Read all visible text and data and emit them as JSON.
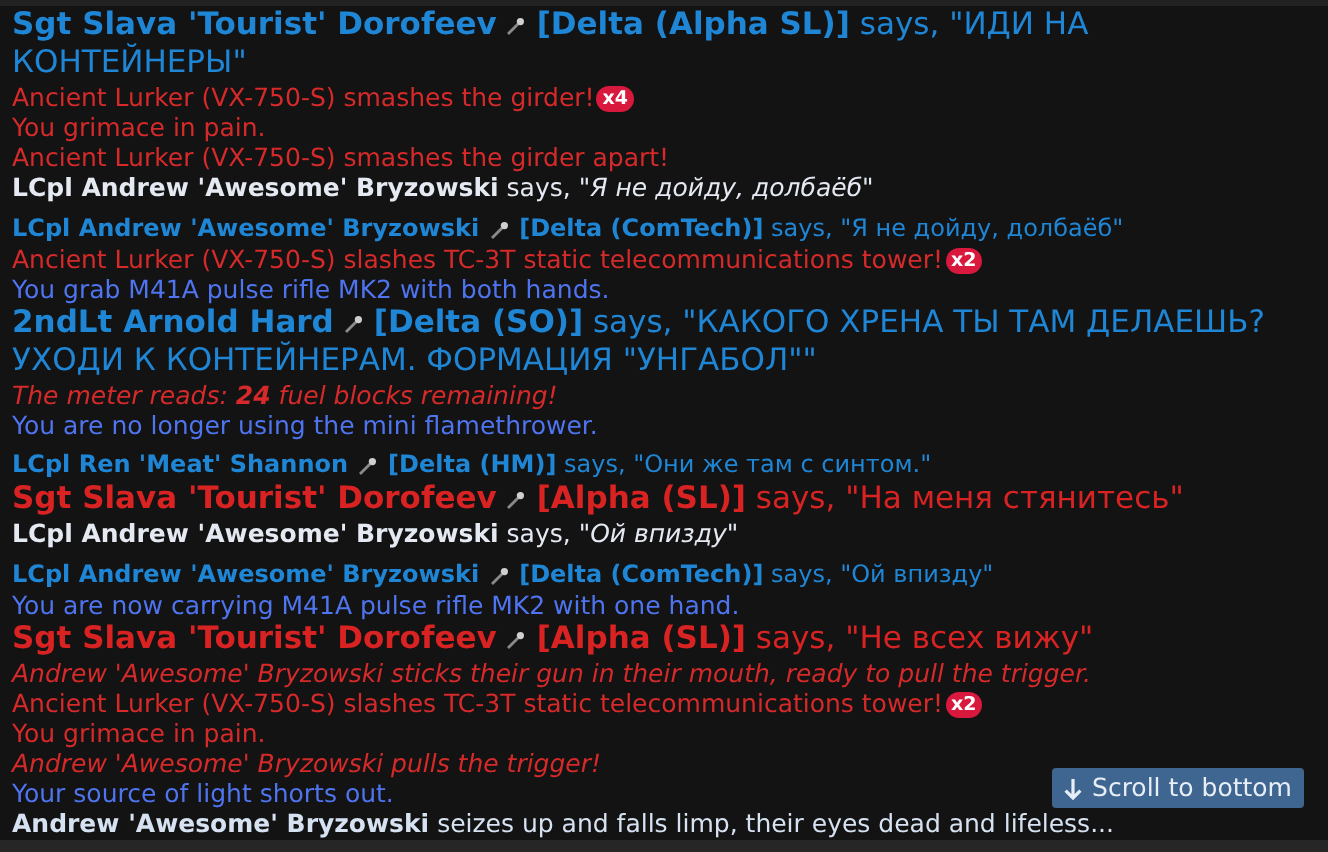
{
  "messages": [
    {
      "kind": "radio",
      "large": true,
      "color": "#1f86d6",
      "speaker": "Sgt Slava 'Tourist' Dorofeev",
      "channel": "[Delta (Alpha SL)]",
      "verb": "says,",
      "speech": "\"ИДИ НА КОНТЕЙНЕРЫ\""
    },
    {
      "kind": "warning",
      "italic": false,
      "text": "Ancient Lurker (VX-750-S) smashes the girder!",
      "count": "x4"
    },
    {
      "kind": "warning",
      "italic": false,
      "text": "You grimace in pain."
    },
    {
      "kind": "warning",
      "italic": false,
      "text": "Ancient Lurker (VX-750-S) smashes the girder apart!"
    },
    {
      "kind": "say",
      "speaker": "LCpl Andrew 'Awesome' Bryzowski",
      "verb": "says,",
      "speech": "\"Я не дойду, долбаёб\""
    },
    {
      "kind": "radio",
      "large": false,
      "color": "#1f86d6",
      "speaker": "LCpl Andrew 'Awesome' Bryzowski",
      "channel": "[Delta (ComTech)]",
      "verb": "says,",
      "speech": "\"Я не дойду, долбаёб\""
    },
    {
      "kind": "warning",
      "italic": false,
      "text": "Ancient Lurker (VX-750-S) slashes TC-3T static telecommunications tower!",
      "count": "x2"
    },
    {
      "kind": "info",
      "text": "You grab M41A pulse rifle MK2 with both hands."
    },
    {
      "kind": "radio",
      "large": true,
      "color": "#1f86d6",
      "speaker": "2ndLt Arnold Hard",
      "channel": "[Delta (SO)]",
      "verb": "says,",
      "speech": "\"КАКОГО ХРЕНА ТЫ ТАМ ДЕЛАЕШЬ? УХОДИ К КОНТЕЙНЕРАМ. ФОРМАЦИЯ \"УНГАБОЛ\"\""
    },
    {
      "kind": "warning",
      "italic": true,
      "text": "The meter reads: **24** fuel blocks remaining!"
    },
    {
      "kind": "info",
      "text": "You are no longer using the mini flamethrower."
    },
    {
      "kind": "radio",
      "large": false,
      "color": "#1f86d6",
      "speaker": "LCpl Ren 'Meat' Shannon",
      "channel": "[Delta (HM)]",
      "verb": "says,",
      "speech": "\"Они же там с синтом.\""
    },
    {
      "kind": "radio",
      "large": true,
      "color": "#d92323",
      "speaker": "Sgt Slava 'Tourist' Dorofeev",
      "channel": "[Alpha (SL)]",
      "verb": "says,",
      "speech": "\"На меня стянитесь\""
    },
    {
      "kind": "say",
      "speaker": "LCpl Andrew 'Awesome' Bryzowski",
      "verb": "says,",
      "speech": "\"Ой впизду\""
    },
    {
      "kind": "radio",
      "large": false,
      "color": "#1f86d6",
      "speaker": "LCpl Andrew 'Awesome' Bryzowski",
      "channel": "[Delta (ComTech)]",
      "verb": "says,",
      "speech": "\"Ой впизду\""
    },
    {
      "kind": "info",
      "text": "You are now carrying M41A pulse rifle MK2 with one hand."
    },
    {
      "kind": "radio",
      "large": true,
      "color": "#d92323",
      "speaker": "Sgt Slava 'Tourist' Dorofeev",
      "channel": "[Alpha (SL)]",
      "verb": "says,",
      "speech": "\"Не всех вижу\""
    },
    {
      "kind": "warning",
      "italic": true,
      "text": "Andrew 'Awesome' Bryzowski sticks their gun in their mouth, ready to pull the trigger."
    },
    {
      "kind": "warning",
      "italic": false,
      "text": "Ancient Lurker (VX-750-S) slashes TC-3T static telecommunications tower!",
      "count": "x2"
    },
    {
      "kind": "warning",
      "italic": false,
      "text": "You grimace in pain."
    },
    {
      "kind": "warning",
      "italic": true,
      "text": "Andrew 'Awesome' Bryzowski pulls the trigger!"
    },
    {
      "kind": "info",
      "text": "Your source of light shorts out."
    },
    {
      "kind": "death",
      "speaker": "Andrew 'Awesome' Bryzowski",
      "text": "seizes up and falls limp, their eyes dead and lifeless..."
    }
  ],
  "scroll_button": {
    "label": "Scroll to bottom"
  }
}
